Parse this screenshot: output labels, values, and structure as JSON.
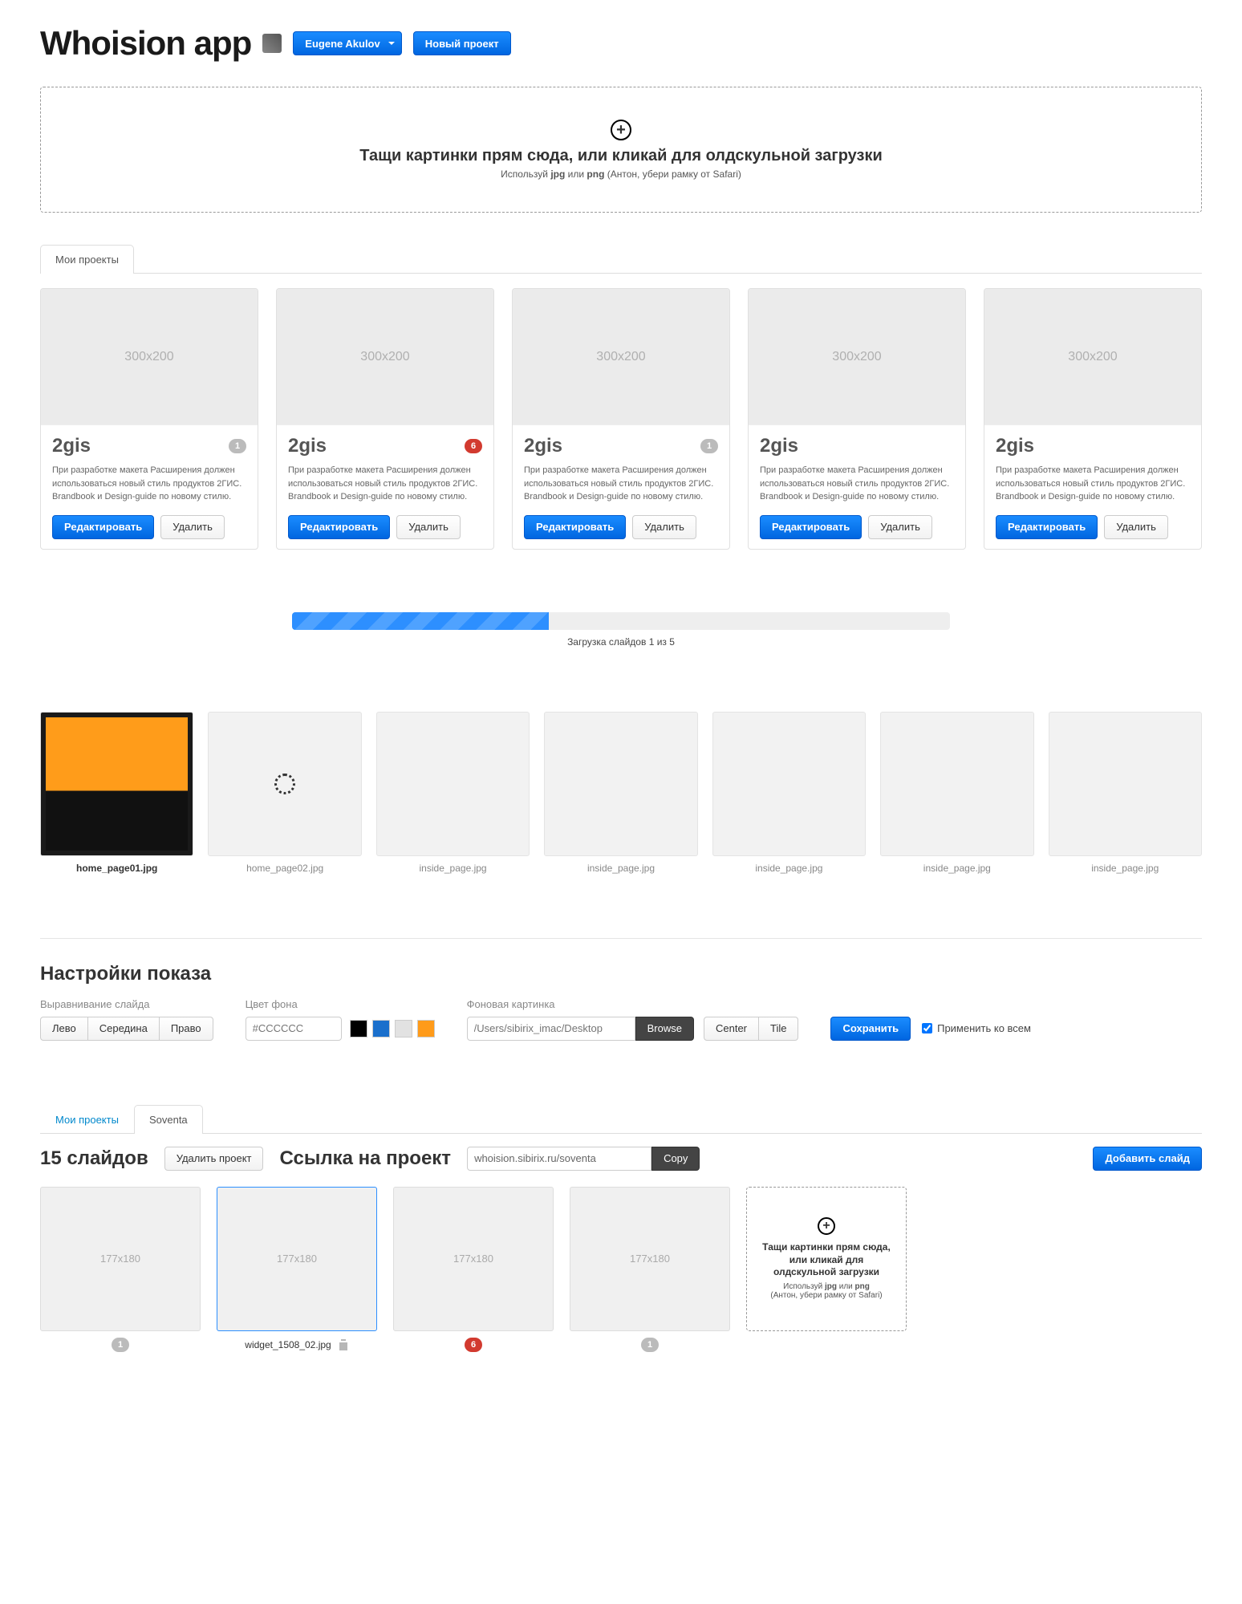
{
  "header": {
    "brand": "Whoision app",
    "user": "Eugene Akulov",
    "new_project": "Новый проект"
  },
  "dropzone": {
    "title": "Тащи картинки прям сюда, или кликай для олдскульной загрузки",
    "sub_prefix": "Используй ",
    "fmt1": "jpg",
    "sub_mid": " или ",
    "fmt2": "png",
    "sub_suffix": " (Антон, убери рамку от Safari)"
  },
  "tabs_my_projects": "Мои проекты",
  "placeholder_thumb": "300x200",
  "cards": [
    {
      "title": "2gis",
      "badge": "1",
      "badge_red": false
    },
    {
      "title": "2gis",
      "badge": "6",
      "badge_red": true
    },
    {
      "title": "2gis",
      "badge": "1",
      "badge_red": false
    },
    {
      "title": "2gis",
      "badge": "",
      "badge_red": false
    },
    {
      "title": "2gis",
      "badge": "",
      "badge_red": false
    }
  ],
  "card_desc": "При разработке макета Расширения должен использоваться новый стиль продуктов 2ГИС. Brandbook и Design-guide по новому стилю.",
  "card_edit": "Редактировать",
  "card_delete": "Удалить",
  "progress_text": "Загрузка слайдов 1 из 5",
  "slides": [
    {
      "name": "home_page01.jpg",
      "state": "img"
    },
    {
      "name": "home_page02.jpg",
      "state": "loading"
    },
    {
      "name": "inside_page.jpg",
      "state": "empty"
    },
    {
      "name": "inside_page.jpg",
      "state": "empty"
    },
    {
      "name": "inside_page.jpg",
      "state": "empty"
    },
    {
      "name": "inside_page.jpg",
      "state": "empty"
    },
    {
      "name": "inside_page.jpg",
      "state": "empty"
    }
  ],
  "settings": {
    "heading": "Настройки показа",
    "align_label": "Выравнивание слайда",
    "align_opts": [
      "Лево",
      "Середина",
      "Право"
    ],
    "bg_color_label": "Цвет фона",
    "bg_color_placeholder": "#CCCCCC",
    "swatches": [
      "#000000",
      "#1a6fcc",
      "#e2e2e2",
      "#ff9b1a"
    ],
    "bg_image_label": "Фоновая картинка",
    "bg_image_placeholder": "/Users/sibirix_imac/Desktop",
    "browse": "Browse",
    "pos_opts": [
      "Center",
      "Tile"
    ],
    "save": "Сохранить",
    "apply_all": "Применить ко всем"
  },
  "tabs2": {
    "my_projects": "Мои проекты",
    "active": "Soventa"
  },
  "project": {
    "count_title": "15 слайдов",
    "delete_project": "Удалить проект",
    "link_label": "Ссылка на проект",
    "link_value": "whoision.sibirix.ru/soventa",
    "copy": "Copy",
    "add_slide": "Добавить слайд"
  },
  "placeholder_177": "177x180",
  "slides2": [
    {
      "label": "",
      "badge": "1",
      "badge_red": false,
      "sel": false,
      "name": ""
    },
    {
      "label": "",
      "badge": "",
      "badge_red": false,
      "sel": true,
      "name": "widget_1508_02.jpg"
    },
    {
      "label": "",
      "badge": "6",
      "badge_red": true,
      "sel": false,
      "name": ""
    },
    {
      "label": "",
      "badge": "1",
      "badge_red": false,
      "sel": false,
      "name": ""
    }
  ],
  "dz_small": {
    "title": "Тащи картинки прям сюда, или кликай для олдскульной загрузки",
    "sub_prefix": "Используй ",
    "fmt1": "jpg",
    "sub_mid": " или ",
    "fmt2": "png",
    "sub_suffix": "(Антон, убери рамку от Safari)"
  }
}
